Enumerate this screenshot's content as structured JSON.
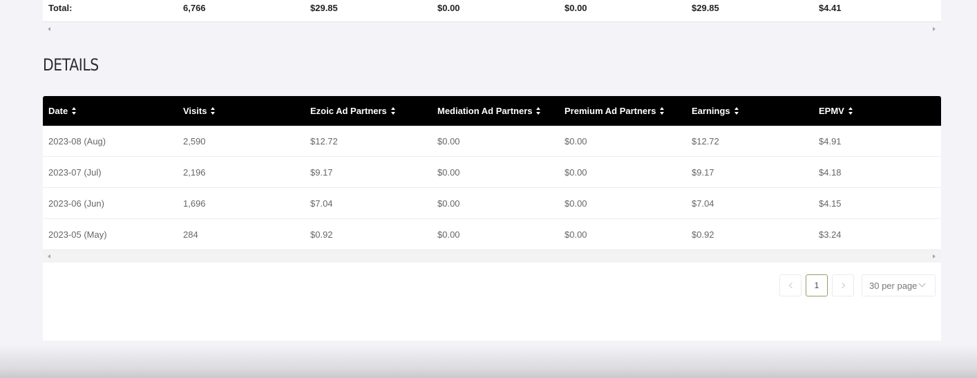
{
  "totals": {
    "label": "Total:",
    "visits": "6,766",
    "ezoic": "$29.85",
    "mediation": "$0.00",
    "premium": "$0.00",
    "earnings": "$29.85",
    "epmv": "$4.41"
  },
  "details": {
    "title": "DETAILS",
    "columns": [
      "Date",
      "Visits",
      "Ezoic Ad Partners",
      "Mediation Ad Partners",
      "Premium Ad Partners",
      "Earnings",
      "EPMV"
    ],
    "rows": [
      [
        "2023-08 (Aug)",
        "2,590",
        "$12.72",
        "$0.00",
        "$0.00",
        "$12.72",
        "$4.91"
      ],
      [
        "2023-07 (Jul)",
        "2,196",
        "$9.17",
        "$0.00",
        "$0.00",
        "$9.17",
        "$4.18"
      ],
      [
        "2023-06 (Jun)",
        "1,696",
        "$7.04",
        "$0.00",
        "$0.00",
        "$7.04",
        "$4.15"
      ],
      [
        "2023-05 (May)",
        "284",
        "$0.92",
        "$0.00",
        "$0.00",
        "$0.92",
        "$3.24"
      ]
    ]
  },
  "pagination": {
    "current_page": "1",
    "per_page": "30 per page"
  },
  "colors": {
    "header_bg": "#000000",
    "current_page_border": "#8ea068"
  },
  "icons": {
    "sort": "sort-icon",
    "prev": "chevron-left-icon",
    "next": "chevron-right-icon",
    "dropdown": "chevron-down-icon"
  }
}
